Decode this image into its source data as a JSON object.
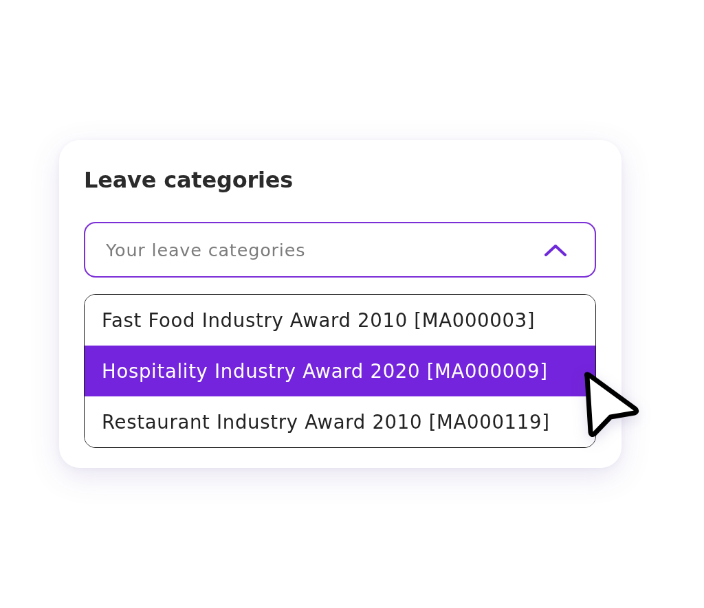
{
  "card": {
    "title": "Leave categories"
  },
  "select": {
    "placeholder": "Your leave categories",
    "expanded": true
  },
  "options": [
    {
      "label": "Fast Food Industry Award 2010 [MA000003]",
      "selected": false
    },
    {
      "label": "Hospitality Industry Award 2020 [MA000009]",
      "selected": true
    },
    {
      "label": "Restaurant Industry Award 2010 [MA000119]",
      "selected": false
    }
  ]
}
